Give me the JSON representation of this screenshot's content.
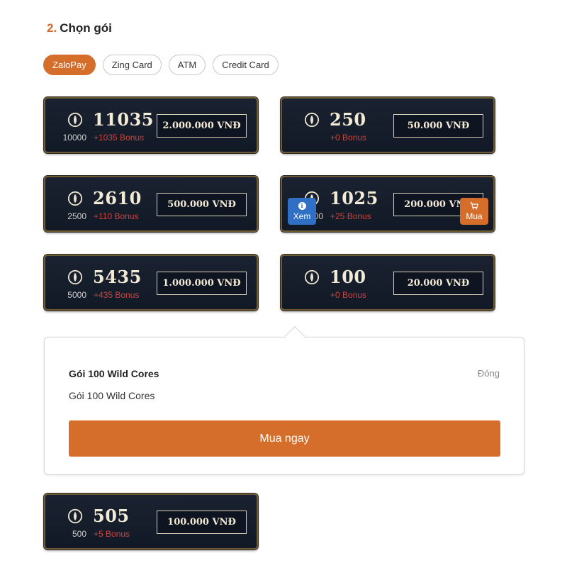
{
  "section": {
    "number": "2.",
    "title": "Chọn gói"
  },
  "tabs": [
    {
      "label": "ZaloPay",
      "active": true
    },
    {
      "label": "Zing Card",
      "active": false
    },
    {
      "label": "ATM",
      "active": false
    },
    {
      "label": "Credit Card",
      "active": false
    }
  ],
  "packages": [
    {
      "amount": "11035",
      "base": "10000",
      "bonus": "+1035 Bonus",
      "price": "2.000.000 VNĐ"
    },
    {
      "amount": "250",
      "base": "",
      "bonus": "+0 Bonus",
      "price": "50.000 VNĐ"
    },
    {
      "amount": "2610",
      "base": "2500",
      "bonus": "+110 Bonus",
      "price": "500.000 VNĐ"
    },
    {
      "amount": "1025",
      "base": "1000",
      "bonus": "+25 Bonus",
      "price": "200.000 VNĐ",
      "hover_view": "Xem",
      "hover_buy": "Mua"
    },
    {
      "amount": "5435",
      "base": "5000",
      "bonus": "+435 Bonus",
      "price": "1.000.000 VNĐ"
    },
    {
      "amount": "100",
      "base": "",
      "bonus": "+0 Bonus",
      "price": "20.000 VNĐ"
    },
    {
      "amount": "505",
      "base": "500",
      "bonus": "+5 Bonus",
      "price": "100.000 VNĐ"
    }
  ],
  "popup": {
    "title": "Gói 100 Wild Cores",
    "close": "Đóng",
    "description": "Gói 100 Wild Cores",
    "buy_now": "Mua ngay"
  },
  "colors": {
    "accent": "#d46e2a",
    "view_button": "#2f6fc4",
    "bonus": "#c9453e",
    "card_bg": "#141b28"
  }
}
